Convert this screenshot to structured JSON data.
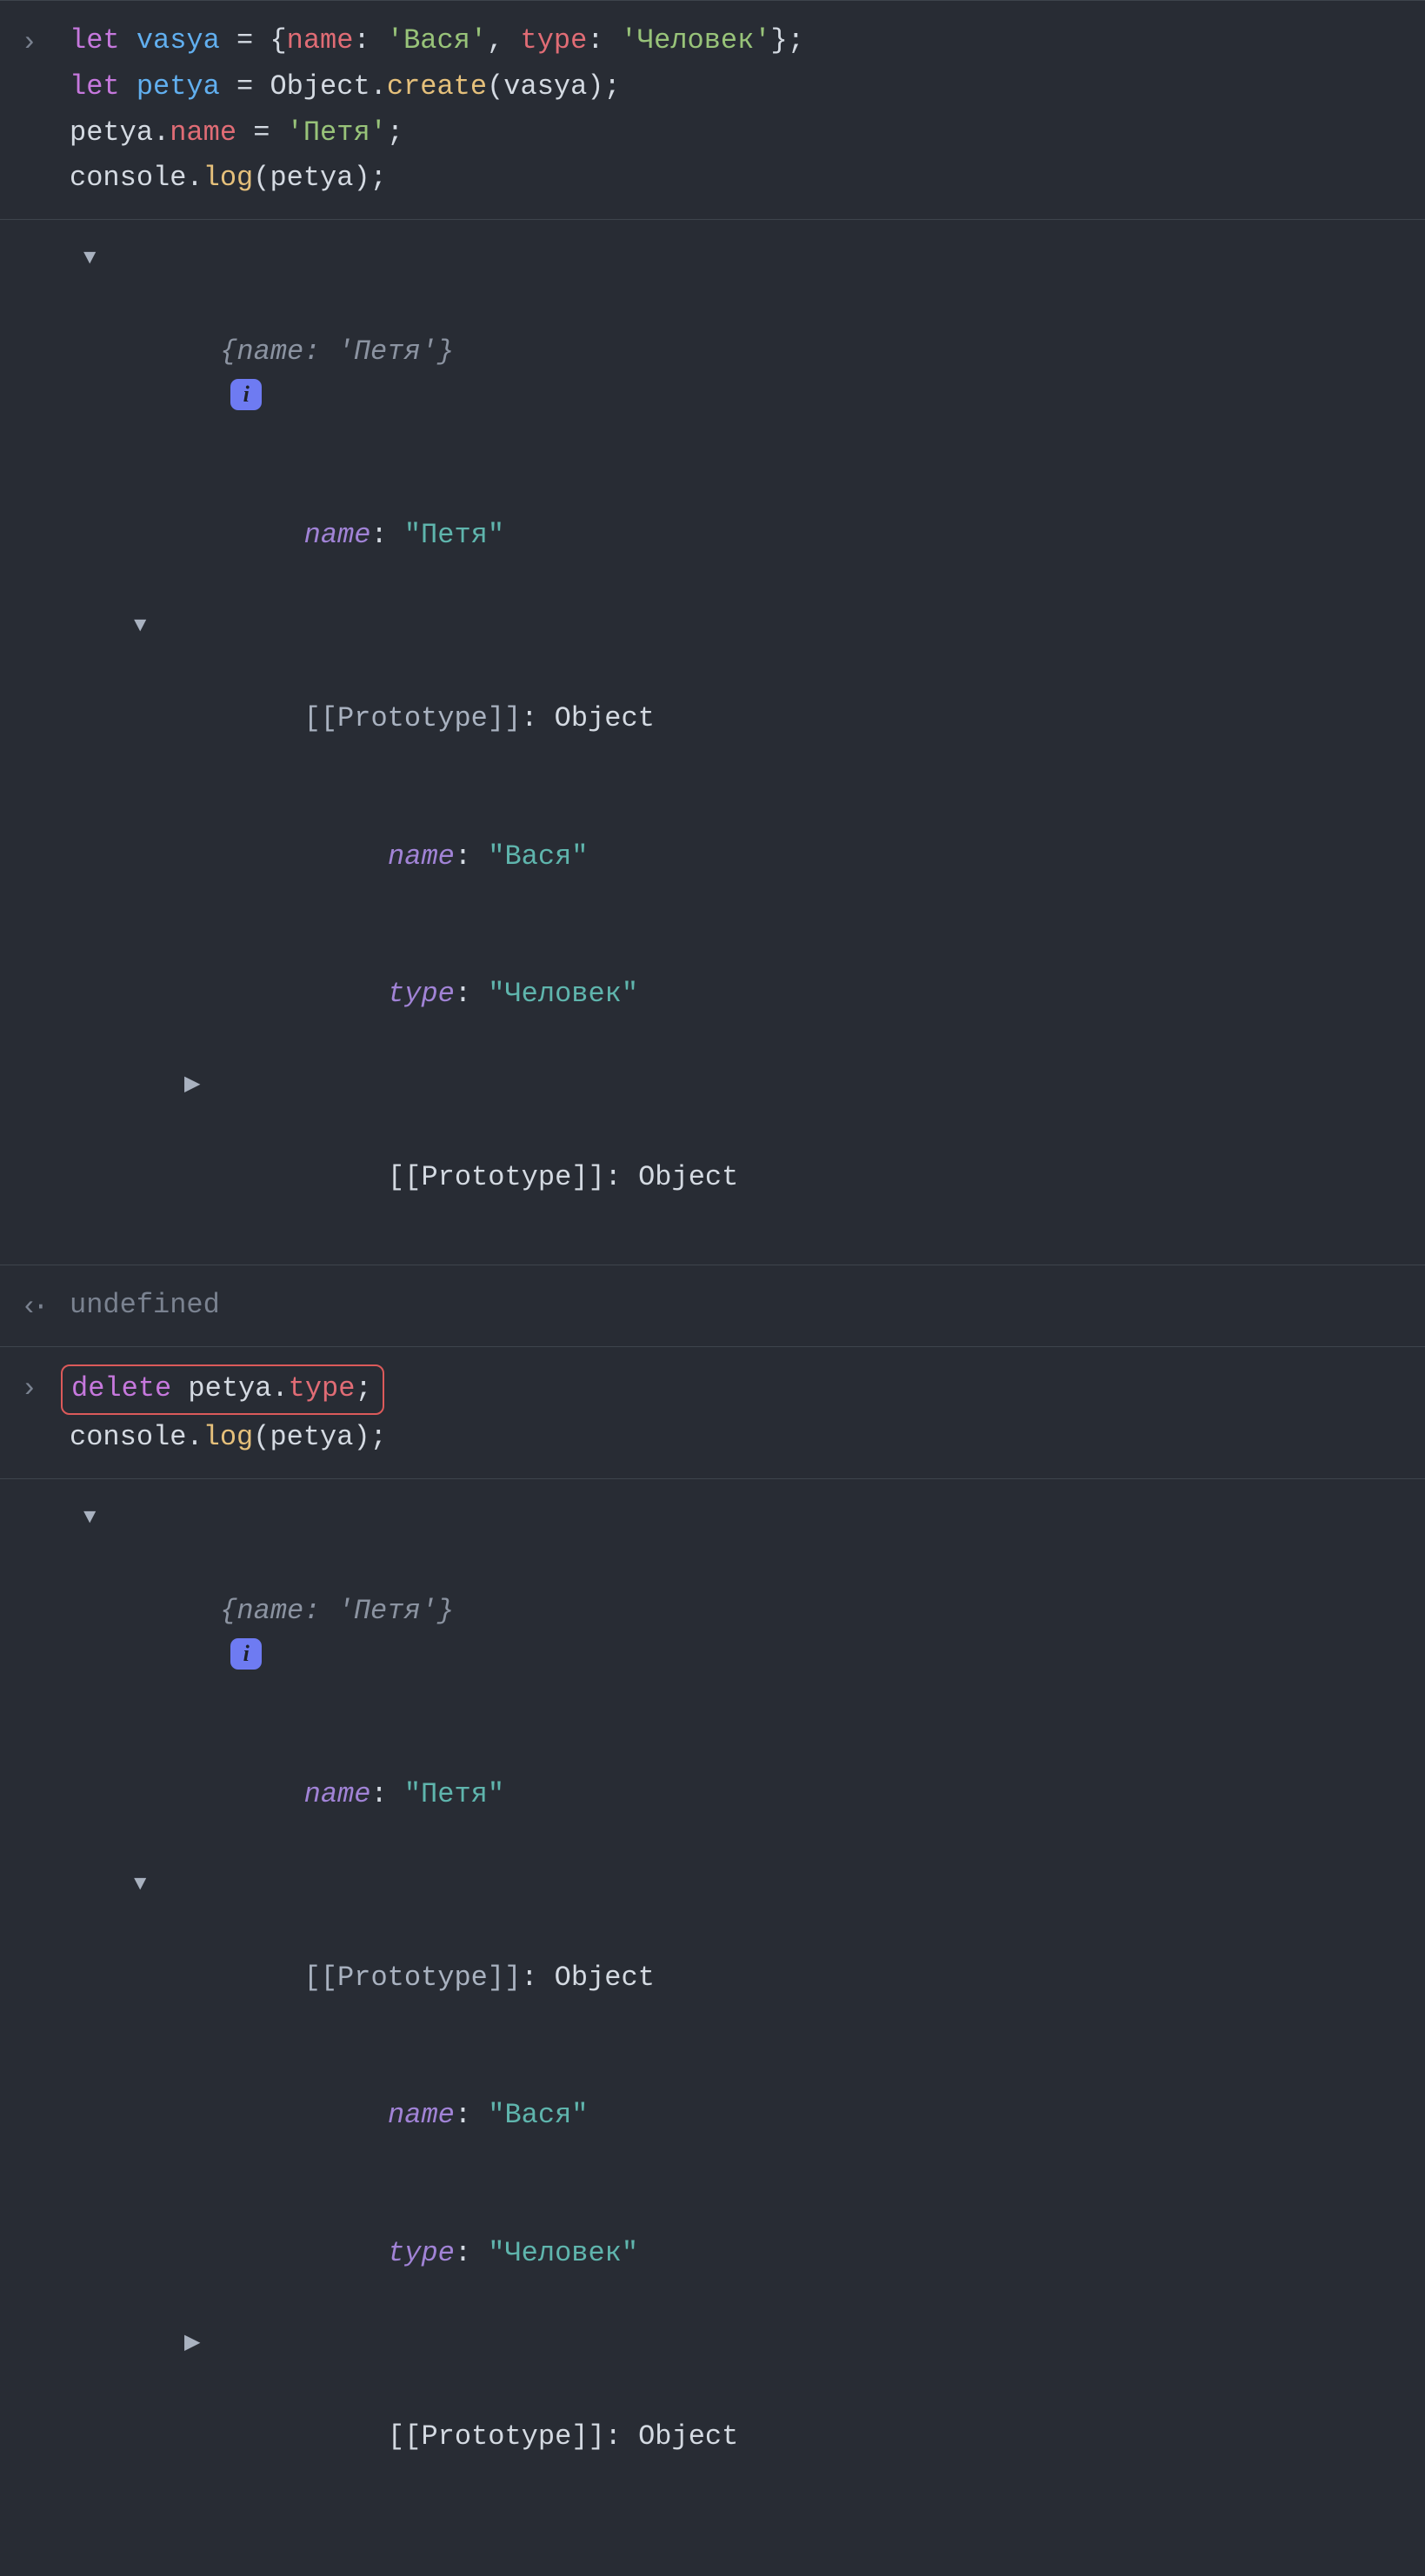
{
  "entry1": {
    "code": {
      "l1a": "let ",
      "l1b": "vasya",
      "l1c": " = {",
      "l1d": "name",
      "l1e": ": ",
      "l1f": "'Вася'",
      "l1g": ", ",
      "l1h": "type",
      "l1i": ": ",
      "l1j": "'Человек'",
      "l1k": "};",
      "l2a": "let ",
      "l2b": "petya",
      "l2c": " = Object.",
      "l2d": "create",
      "l2e": "(vasya);",
      "l3a": "petya.",
      "l3b": "name",
      "l3c": " = ",
      "l3d": "'Петя'",
      "l3e": ";",
      "l4a": "console.",
      "l4b": "log",
      "l4c": "(petya);"
    }
  },
  "out1": {
    "preview_open": "{",
    "preview_name_k": "name",
    "preview_sep": ": ",
    "preview_name_v": "'Петя'",
    "preview_close": "}",
    "badge": "i",
    "name_k": "name",
    "name_sep": ": ",
    "name_v": "\"Петя\"",
    "proto_label": "[[Prototype]]",
    "proto_sep": ": ",
    "proto_val": "Object",
    "proto_name_k": "name",
    "proto_name_sep": ": ",
    "proto_name_v": "\"Вася\"",
    "proto_type_k": "type",
    "proto_type_sep": ": ",
    "proto_type_v": "\"Человек\"",
    "proto2_label": "[[Prototype]]",
    "proto2_sep": ": ",
    "proto2_val": "Object"
  },
  "return1": {
    "value": "undefined"
  },
  "entry2": {
    "code": {
      "l1a": "delete ",
      "l1b": "petya.",
      "l1c": "type",
      "l1d": ";",
      "l2a": "console.",
      "l2b": "log",
      "l2c": "(petya);"
    }
  },
  "out2": {
    "preview_open": "{",
    "preview_name_k": "name",
    "preview_sep": ": ",
    "preview_name_v": "'Петя'",
    "preview_close": "}",
    "badge": "i",
    "name_k": "name",
    "name_sep": ": ",
    "name_v": "\"Петя\"",
    "proto_label": "[[Prototype]]",
    "proto_sep": ": ",
    "proto_val": "Object",
    "proto_name_k": "name",
    "proto_name_sep": ": ",
    "proto_name_v": "\"Вася\"",
    "proto_type_k": "type",
    "proto_type_sep": ": ",
    "proto_type_v": "\"Человек\"",
    "proto2_label": "[[Prototype]]",
    "proto2_sep": ": ",
    "proto2_val": "Object"
  },
  "glyphs": {
    "input": "›",
    "return": "‹·"
  }
}
